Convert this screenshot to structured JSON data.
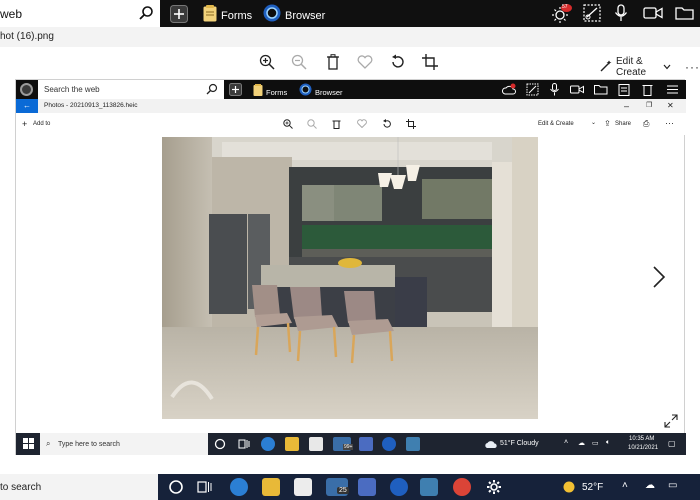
{
  "outer_topbar": {
    "search_text": "web",
    "forms_label": "Forms",
    "browser_label": "Browser",
    "notification_badge": "57"
  },
  "outer_title": {
    "filename": "hot (16).png"
  },
  "outer_toolbar": {
    "edit_create_label": "Edit & Create"
  },
  "inner_topbar": {
    "search_placeholder": "Search the web",
    "forms_label": "Forms",
    "browser_label": "Browser"
  },
  "inner_title": {
    "filename": "Photos - 20210913_113826.heic"
  },
  "inner_toolbar": {
    "add_to_label": "Add to",
    "edit_create_label": "Edit & Create",
    "share_label": "Share"
  },
  "inner_taskbar": {
    "search_placeholder": "Type here to search",
    "badge": "99+",
    "weather": "51°F  Cloudy",
    "time": "10:35 AM",
    "date": "10/21/2021"
  },
  "outer_taskbar": {
    "search_placeholder": "to search",
    "badge": "25",
    "temperature": "52°F"
  },
  "colors": {
    "topbar": "#101010",
    "accent_blue": "#0a6ad6",
    "taskbar": "#16223a"
  }
}
